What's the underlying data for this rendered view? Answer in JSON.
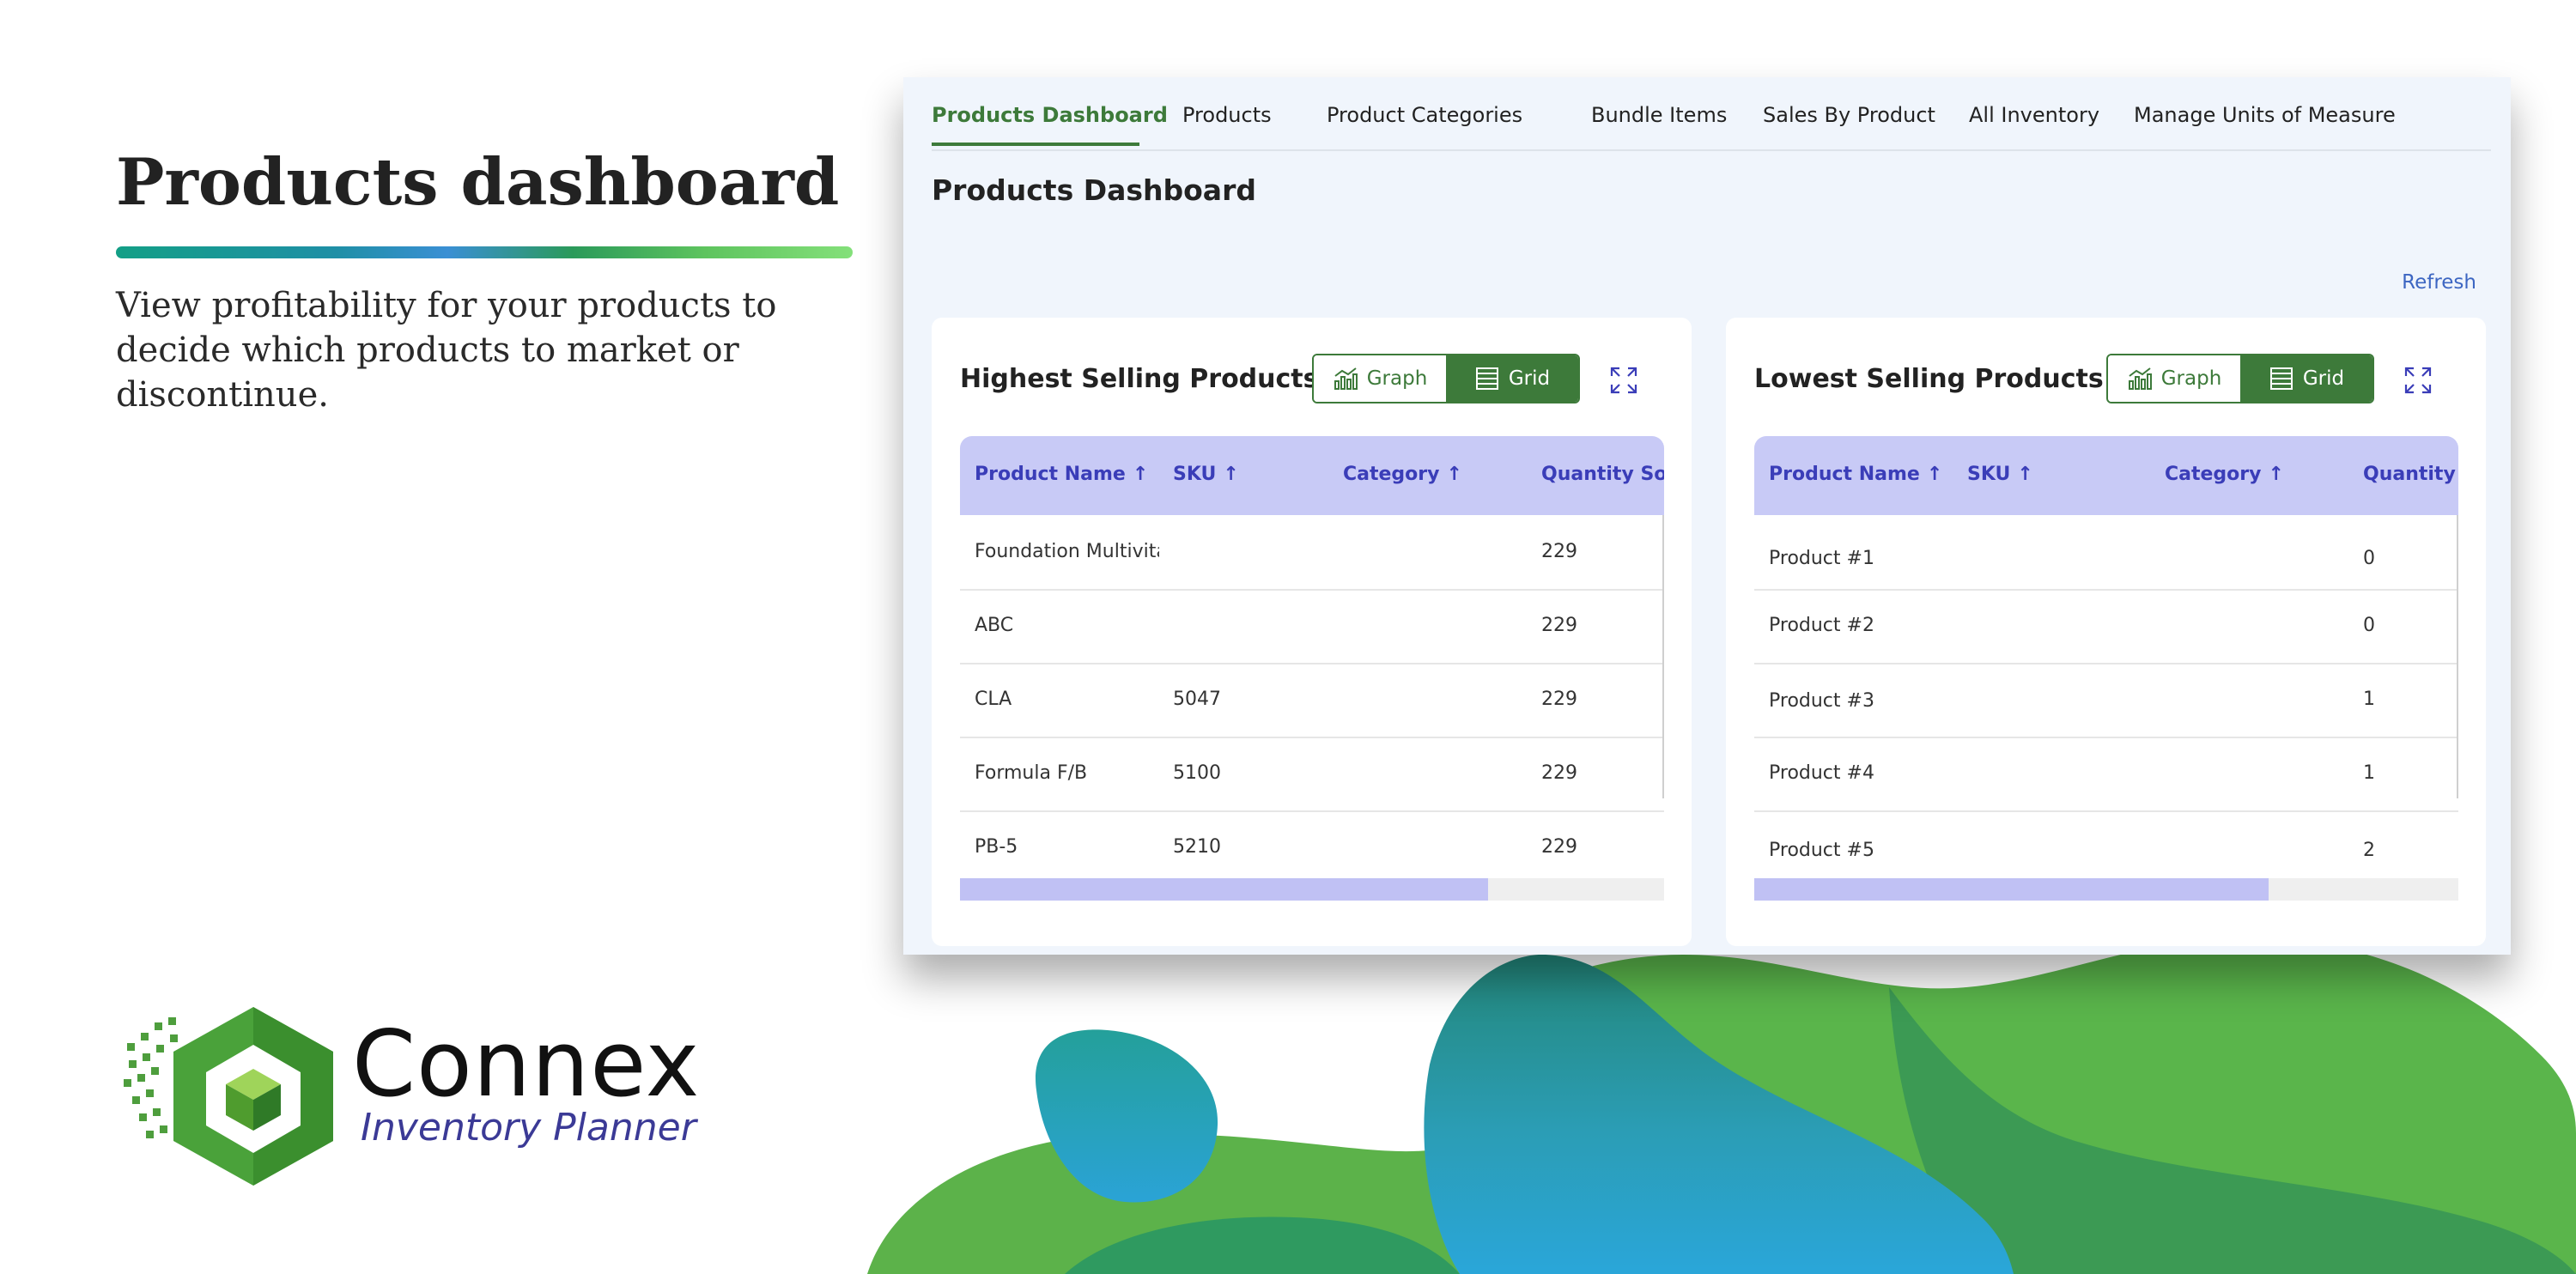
{
  "promo": {
    "title": "Products dashboard",
    "description": "View profitability for your products to decide which products to market or discontinue."
  },
  "logo": {
    "name": "Connex",
    "subtitle": "Inventory Planner"
  },
  "tabs": [
    {
      "label": "Products Dashboard",
      "active": true
    },
    {
      "label": "Products",
      "active": false
    },
    {
      "label": "Product Categories",
      "active": false
    },
    {
      "label": "Bundle Items",
      "active": false
    },
    {
      "label": "Sales By Product",
      "active": false
    },
    {
      "label": "All Inventory",
      "active": false
    },
    {
      "label": "Manage Units of Measure",
      "active": false
    }
  ],
  "page_title": "Products Dashboard",
  "refresh_label": "Refresh",
  "cards": [
    {
      "title": "Highest Selling Products",
      "toggle": {
        "graph": "Graph",
        "grid": "Grid",
        "selected": "Grid"
      },
      "columns": [
        "Product Name",
        "SKU",
        "Category",
        "Quantity Sold"
      ],
      "rows": [
        {
          "name": "Foundation Multivita",
          "sku": "",
          "category": "",
          "qty": "229"
        },
        {
          "name": "ABC",
          "sku": "",
          "category": "",
          "qty": "229"
        },
        {
          "name": "CLA",
          "sku": "5047",
          "category": "",
          "qty": "229"
        },
        {
          "name": "Formula F/B",
          "sku": "5100",
          "category": "",
          "qty": "229"
        },
        {
          "name": "PB-5",
          "sku": "5210",
          "category": "",
          "qty": "229"
        }
      ],
      "scroll_fraction": 0.75
    },
    {
      "title": "Lowest Selling Products",
      "toggle": {
        "graph": "Graph",
        "grid": "Grid",
        "selected": "Grid"
      },
      "columns": [
        "Product Name",
        "SKU",
        "Category",
        "Quantity S"
      ],
      "rows": [
        {
          "name": "Product #1",
          "sku": "",
          "category": "",
          "qty": "0"
        },
        {
          "name": "Product #2",
          "sku": "",
          "category": "",
          "qty": "0"
        },
        {
          "name": "Product #3",
          "sku": "",
          "category": "",
          "qty": "1"
        },
        {
          "name": "Product #4",
          "sku": "",
          "category": "",
          "qty": "1"
        },
        {
          "name": "Product #5",
          "sku": "",
          "category": "",
          "qty": "2"
        }
      ],
      "scroll_fraction": 0.73
    }
  ],
  "colors": {
    "accent_green": "#3d7a3a",
    "header_purple": "#c8caf6",
    "header_text": "#3a3db8",
    "link_blue": "#3d66c2"
  }
}
